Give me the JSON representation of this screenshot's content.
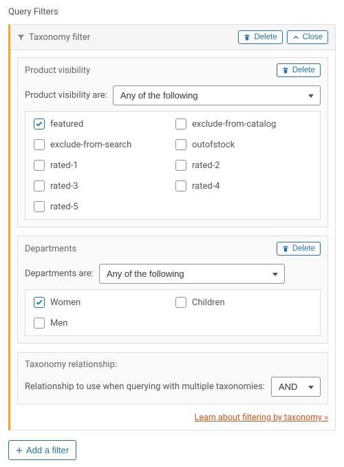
{
  "page_title": "Query Filters",
  "panel": {
    "title": "Taxonomy filter",
    "delete_label": "Delete",
    "close_label": "Close"
  },
  "product_visibility": {
    "title": "Product visibility",
    "delete_label": "Delete",
    "selector_label": "Product visibility are:",
    "selector_value": "Any of the following",
    "options": [
      {
        "label": "featured",
        "checked": true
      },
      {
        "label": "exclude-from-catalog",
        "checked": false
      },
      {
        "label": "exclude-from-search",
        "checked": false
      },
      {
        "label": "outofstock",
        "checked": false
      },
      {
        "label": "rated-1",
        "checked": false
      },
      {
        "label": "rated-2",
        "checked": false
      },
      {
        "label": "rated-3",
        "checked": false
      },
      {
        "label": "rated-4",
        "checked": false
      },
      {
        "label": "rated-5",
        "checked": false
      }
    ]
  },
  "departments": {
    "title": "Departments",
    "delete_label": "Delete",
    "selector_label": "Departments are:",
    "selector_value": "Any of the following",
    "options": [
      {
        "label": "Women",
        "checked": true
      },
      {
        "label": "Children",
        "checked": false
      },
      {
        "label": "Men",
        "checked": false
      }
    ]
  },
  "relationship": {
    "title": "Taxonomy relationship:",
    "label": "Relationship to use when querying with multiple taxonomies:",
    "value": "AND"
  },
  "learn_link": "Learn about filtering by taxonomy »",
  "add_filter_label": "Add a filter"
}
